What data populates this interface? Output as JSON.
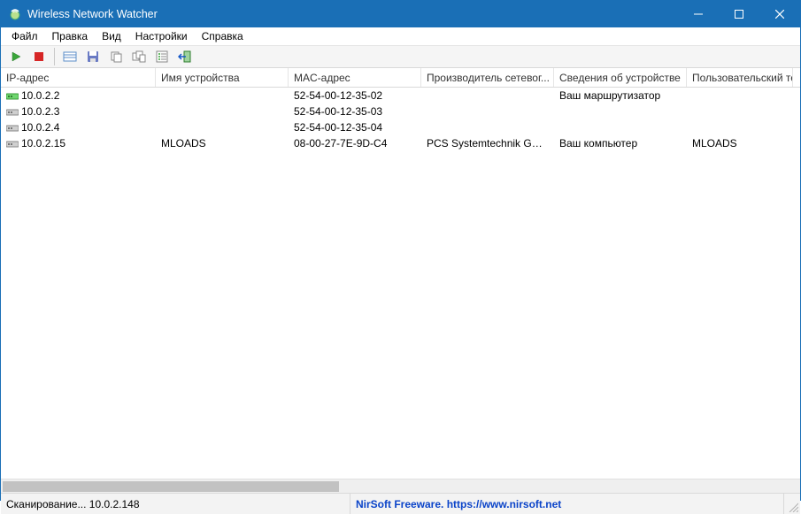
{
  "window": {
    "title": "Wireless Network Watcher"
  },
  "menubar": {
    "items": [
      "Файл",
      "Правка",
      "Вид",
      "Настройки",
      "Справка"
    ]
  },
  "toolbar": {
    "icons": [
      "play-icon",
      "stop-icon",
      "_sep",
      "properties-icon",
      "save-icon",
      "copy-icon",
      "copy-multi-icon",
      "find-icon",
      "exit-icon"
    ]
  },
  "columns": [
    "IP-адрес",
    "Имя устройства",
    "MAC-адрес",
    "Производитель сетевог...",
    "Сведения об устройстве",
    "Пользовательский текст"
  ],
  "rows": [
    {
      "icon": "device-green",
      "ip": "10.0.2.2",
      "name": "",
      "mac": "52-54-00-12-35-02",
      "vendor": "",
      "info": "Ваш маршрутизатор",
      "user": ""
    },
    {
      "icon": "device-grey",
      "ip": "10.0.2.3",
      "name": "",
      "mac": "52-54-00-12-35-03",
      "vendor": "",
      "info": "",
      "user": ""
    },
    {
      "icon": "device-grey",
      "ip": "10.0.2.4",
      "name": "",
      "mac": "52-54-00-12-35-04",
      "vendor": "",
      "info": "",
      "user": ""
    },
    {
      "icon": "device-grey",
      "ip": "10.0.2.15",
      "name": "MLOADS",
      "mac": "08-00-27-7E-9D-C4",
      "vendor": "PCS Systemtechnik Gm...",
      "info": "Ваш компьютер",
      "user": "MLOADS"
    }
  ],
  "status": {
    "scan_text": "Сканирование... 10.0.2.148",
    "link_text": "NirSoft Freeware. https://www.nirsoft.net"
  }
}
